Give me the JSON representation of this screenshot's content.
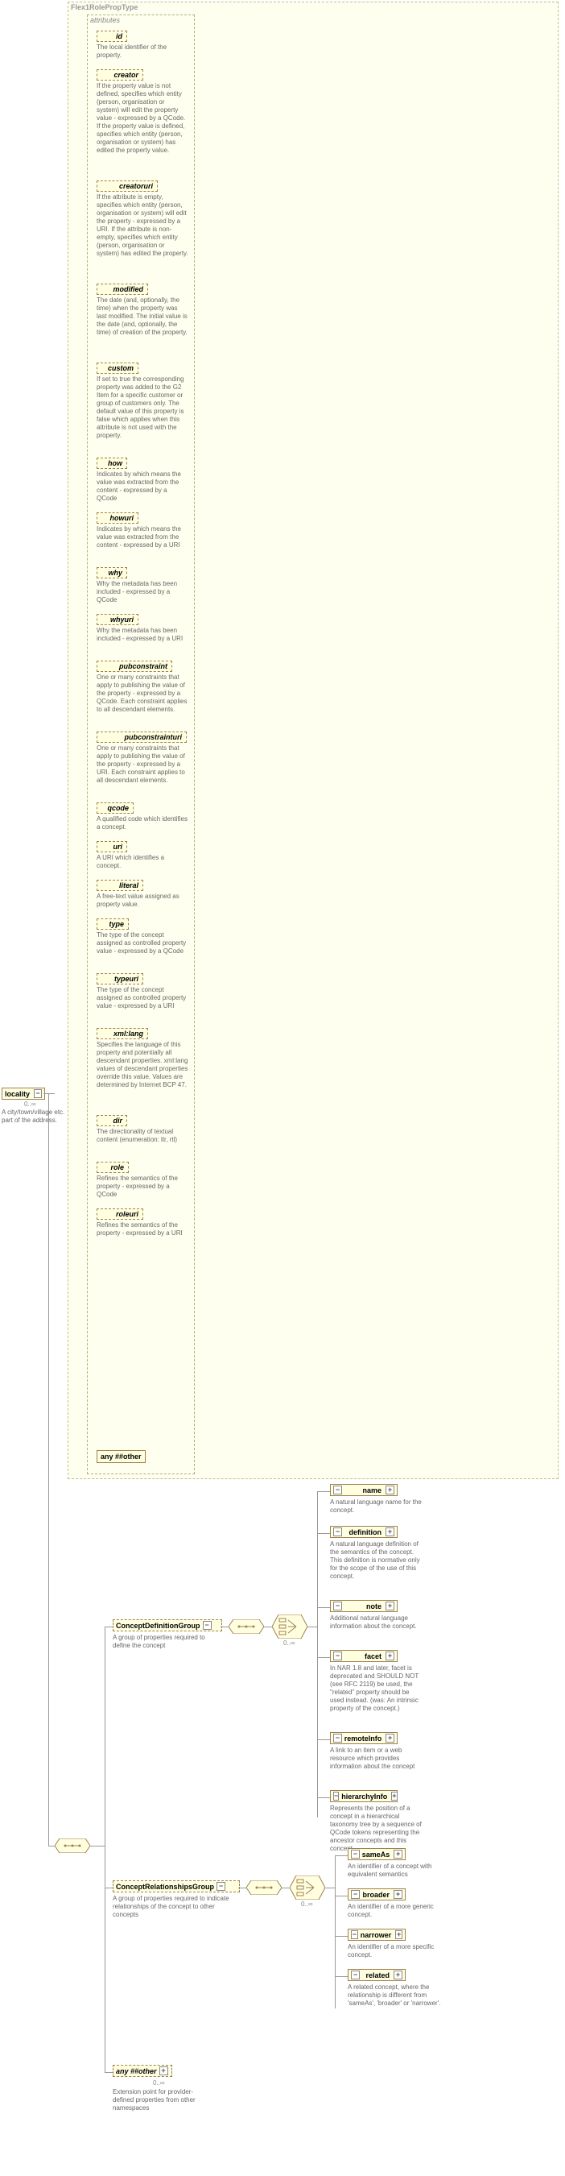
{
  "root": {
    "title": "locality",
    "occ": "0..∞",
    "desc": "A city/town/village etc. part of the address."
  },
  "typeLabel": "Flex1RolePropType",
  "attrGroupLabel": "attributes",
  "attributes": [
    {
      "name": "id",
      "desc": "The local identifier of the property."
    },
    {
      "name": "creator",
      "desc": "If the property value is not defined, specifies which entity (person, organisation or system) will edit the property value - expressed by a QCode. If the property value is defined, specifies which entity (person, organisation or system) has edited the property value."
    },
    {
      "name": "creatoruri",
      "desc": "If the attribute is empty, specifies which entity (person, organisation or system) will edit the property - expressed by a URI. If the attribute is non-empty, specifies which entity (person, organisation or system) has edited the property."
    },
    {
      "name": "modified",
      "desc": "The date (and, optionally, the time) when the property was last modified. The initial value is the date (and, optionally, the time) of creation of the property."
    },
    {
      "name": "custom",
      "desc": "If set to true the corresponding property was added to the G2 Item for a specific customer or group of customers only. The default value of this property is false which applies when this attribute is not used with the property."
    },
    {
      "name": "how",
      "desc": "Indicates by which means the value was extracted from the content - expressed by a QCode"
    },
    {
      "name": "howuri",
      "desc": "Indicates by which means the value was extracted from the content - expressed by a URI"
    },
    {
      "name": "why",
      "desc": "Why the metadata has been included - expressed by a QCode"
    },
    {
      "name": "whyuri",
      "desc": "Why the metadata has been included - expressed by a URI"
    },
    {
      "name": "pubconstraint",
      "desc": "One or many constraints that apply to publishing the value of the property - expressed by a QCode. Each constraint applies to all descendant elements."
    },
    {
      "name": "pubconstrainturi",
      "desc": "One or many constraints that apply to publishing the value of the property - expressed by a URI. Each constraint applies to all descendant elements."
    },
    {
      "name": "qcode",
      "desc": "A qualified code which identifies a concept."
    },
    {
      "name": "uri",
      "desc": "A URI which identifies a concept."
    },
    {
      "name": "literal",
      "desc": "A free-text value assigned as property value."
    },
    {
      "name": "type",
      "desc": "The type of the concept assigned as controlled property value - expressed by a QCode"
    },
    {
      "name": "typeuri",
      "desc": "The type of the concept assigned as controlled property value - expressed by a URI"
    },
    {
      "name": "xml:lang",
      "desc": "Specifies the language of this property and potentially all descendant properties. xml:lang values of descendant properties override this value. Values are determined by Internet BCP 47."
    },
    {
      "name": "dir",
      "desc": "The directionality of textual content (enumeration: ltr, rtl)"
    },
    {
      "name": "role",
      "desc": "Refines the semantics of the property - expressed by a QCode"
    },
    {
      "name": "roleuri",
      "desc": "Refines the semantics of the property - expressed by a URI"
    }
  ],
  "anyOther": "any ##other",
  "cdg": {
    "title": "ConceptDefinitionGroup",
    "desc": "A group of properties required to define the concept"
  },
  "crg": {
    "title": "ConceptRelationshipsGroup",
    "desc": "A group of properties required to indicate relationships of the concept to other concepts"
  },
  "anyOther2": {
    "title": "any ##other",
    "occ": "0..∞",
    "desc": "Extension point for provider-defined properties from other namespaces"
  },
  "defChildren": [
    {
      "name": "name",
      "desc": "A natural language name for the concept."
    },
    {
      "name": "definition",
      "desc": "A natural language definition of the semantics of the concept. This definition is normative only for the scope of the use of this concept."
    },
    {
      "name": "note",
      "desc": "Additional natural language information about the concept."
    },
    {
      "name": "facet",
      "desc": "In NAR 1.8 and later, facet is deprecated and SHOULD NOT (see RFC 2119) be used, the \"related\" property should be used instead. (was: An intrinsic property of the concept.)"
    },
    {
      "name": "remoteInfo",
      "desc": "A link to an item or a web resource which provides information about the concept"
    },
    {
      "name": "hierarchyInfo",
      "desc": "Represents the position of a concept in a hierarchical taxonomy tree by a sequence of QCode tokens representing the ancestor concepts and this concept"
    }
  ],
  "relChildren": [
    {
      "name": "sameAs",
      "desc": "An identifier of a concept with equivalent semantics"
    },
    {
      "name": "broader",
      "desc": "An identifier of a more generic concept."
    },
    {
      "name": "narrower",
      "desc": "An identifier of a more specific concept."
    },
    {
      "name": "related",
      "desc": "A related concept, where the relationship is different from 'sameAs', 'broader' or 'narrower'."
    }
  ],
  "sequenceOcc": "0..∞",
  "choiceOcc": "0..∞"
}
